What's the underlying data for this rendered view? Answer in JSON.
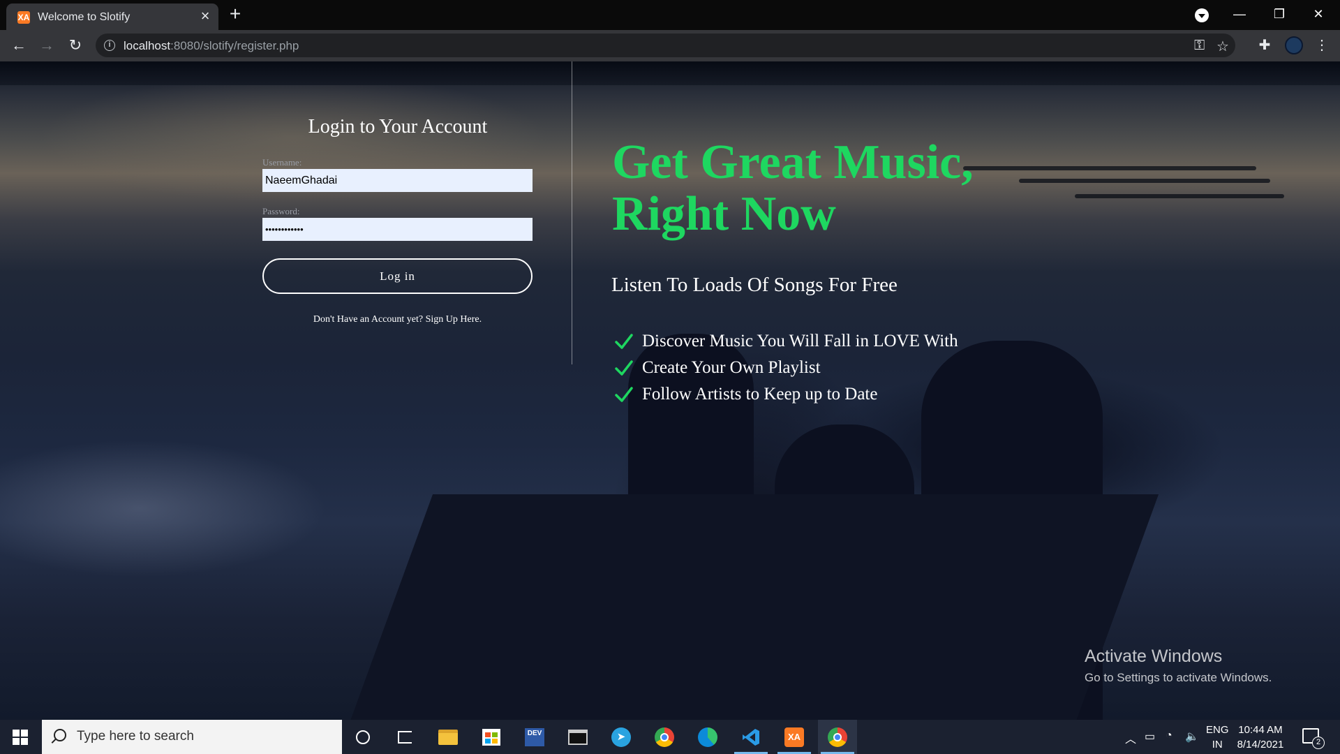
{
  "browser": {
    "tab_title": "Welcome to Slotify",
    "favicon_text": "XA",
    "tab_close": "×",
    "new_tab": "+",
    "url_host": "localhost",
    "url_rest": ":8080/slotify/register.php",
    "win_minimize": "—",
    "win_restore": "❐",
    "win_close": "✕"
  },
  "login": {
    "title": "Login to Your Account",
    "username_label": "Username:",
    "username_value": "NaeemGhadai",
    "password_label": "Password:",
    "password_value": "••••••••••••",
    "button_label": "Log in",
    "signup_text": "Don't Have an Account yet? Sign Up Here."
  },
  "promo": {
    "headline_line1": "Get Great Music,",
    "headline_line2": "Right Now",
    "subheading": "Listen To Loads Of Songs For Free",
    "features": [
      "Discover Music You Will Fall in LOVE With",
      "Create Your Own Playlist",
      "Follow Artists to Keep up to Date"
    ],
    "accent_color": "#1ed760"
  },
  "watermark": {
    "line1": "Activate Windows",
    "line2": "Go to Settings to activate Windows."
  },
  "taskbar": {
    "search_placeholder": "Type here to search",
    "devto_label": "DEV",
    "lang_line1": "ENG",
    "lang_line2": "IN",
    "time": "10:44 AM",
    "date": "8/14/2021",
    "notification_count": "2"
  }
}
